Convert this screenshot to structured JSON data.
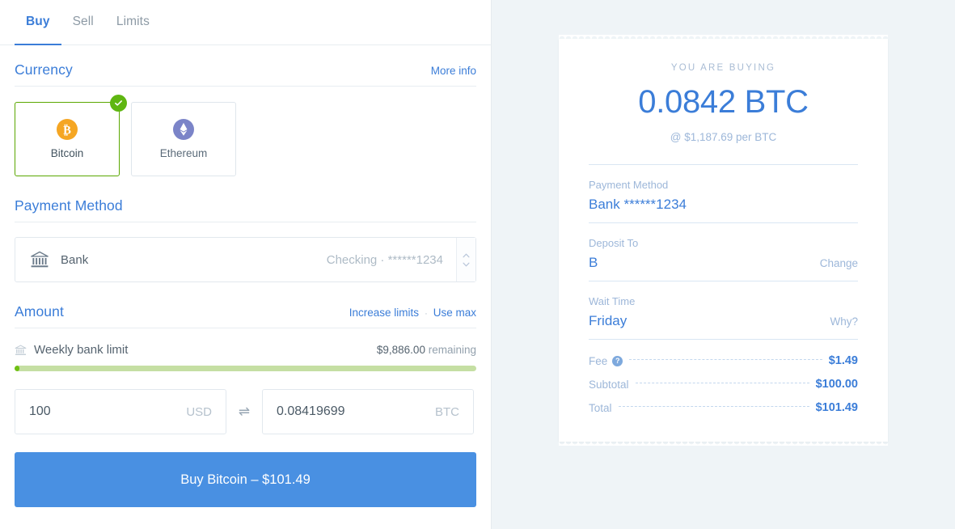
{
  "tabs": [
    {
      "label": "Buy",
      "active": true
    },
    {
      "label": "Sell",
      "active": false
    },
    {
      "label": "Limits",
      "active": false
    }
  ],
  "currency_section": {
    "title": "Currency",
    "more_info": "More info",
    "options": [
      {
        "label": "Bitcoin",
        "icon": "bitcoin-icon",
        "selected": true,
        "color": "#f5a623"
      },
      {
        "label": "Ethereum",
        "icon": "ethereum-icon",
        "selected": false,
        "color": "#7b84c8"
      }
    ],
    "selected_badge": "check-icon",
    "selected_border_color": "#5aa700"
  },
  "payment_section": {
    "title": "Payment Method",
    "method_name": "Bank",
    "method_detail": "Checking · ******1234",
    "icon": "bank-icon"
  },
  "amount_section": {
    "title": "Amount",
    "increase_limits": "Increase limits",
    "separator": "·",
    "use_max": "Use max",
    "limit_label": "Weekly bank limit",
    "limit_icon": "bank-icon",
    "limit_remaining_value": "$9,886.00",
    "limit_remaining_suffix": "remaining",
    "progress_percent": 1,
    "fiat_value": "100",
    "fiat_currency": "USD",
    "crypto_value": "0.08419699",
    "crypto_currency": "BTC",
    "swap_icon": "⇌"
  },
  "buy_button": {
    "label": "Buy Bitcoin – $101.49",
    "color": "#4990e2"
  },
  "receipt": {
    "heading": "YOU ARE BUYING",
    "amount": "0.0842 BTC",
    "rate": "@ $1,187.69 per BTC",
    "details": [
      {
        "label": "Payment Method",
        "value": "Bank ******1234",
        "action": ""
      },
      {
        "label": "Deposit To",
        "value": "B",
        "action": "Change"
      },
      {
        "label": "Wait Time",
        "value": "Friday",
        "action": "Why?"
      }
    ],
    "totals": [
      {
        "label": "Fee",
        "has_help": true,
        "value": "$1.49"
      },
      {
        "label": "Subtotal",
        "has_help": false,
        "value": "$100.00"
      },
      {
        "label": "Total",
        "has_help": false,
        "value": "$101.49"
      }
    ]
  }
}
